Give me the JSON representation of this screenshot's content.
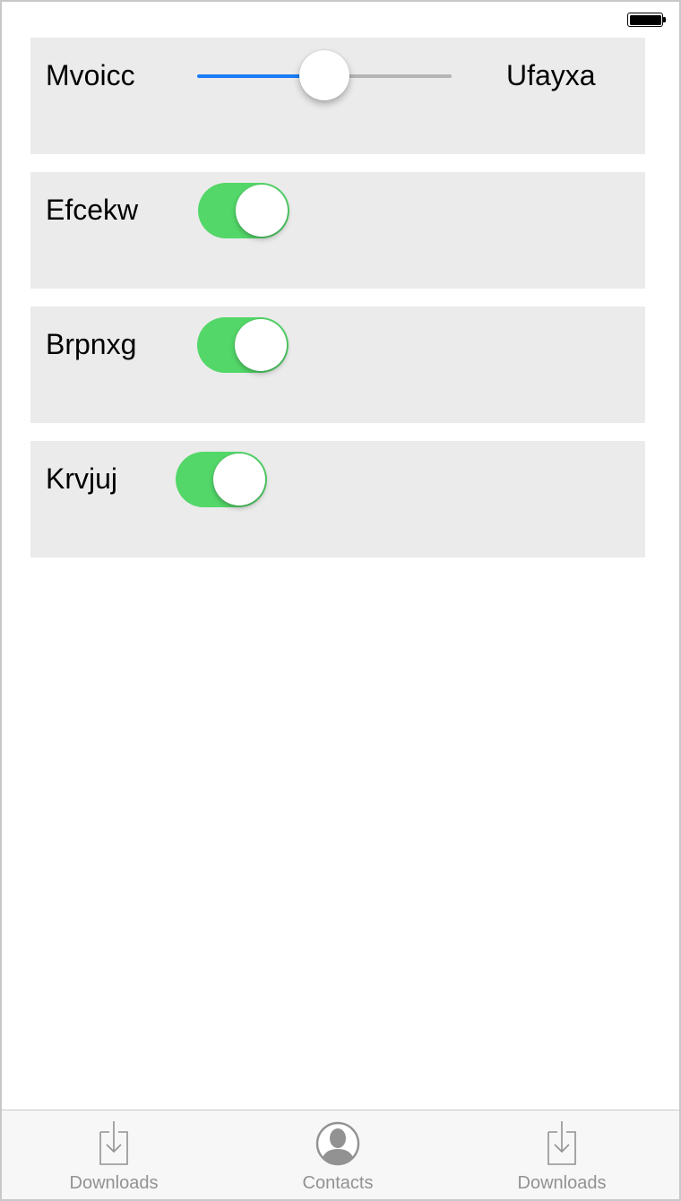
{
  "status_bar": {
    "battery_icon": "battery-full-icon",
    "battery_level": 1.0
  },
  "rows": [
    {
      "type": "slider",
      "label_left": "Mvoicc",
      "label_right": "Ufayxa",
      "value": 0.5
    },
    {
      "type": "toggle",
      "label": "Efcekw",
      "on": true
    },
    {
      "type": "toggle",
      "label": "Brpnxg",
      "on": true
    },
    {
      "type": "toggle",
      "label": "Krvjuj",
      "on": true
    }
  ],
  "tab_bar": {
    "tabs": [
      {
        "label": "Downloads",
        "icon": "download-icon"
      },
      {
        "label": "Contacts",
        "icon": "contact-icon"
      },
      {
        "label": "Downloads",
        "icon": "download-icon"
      }
    ]
  },
  "colors": {
    "toggle_on": "#53d769",
    "slider_min_track": "#1a7cf5",
    "slider_max_track": "#b5b5b5",
    "card_background": "#ebebeb",
    "tab_label": "#929292"
  }
}
